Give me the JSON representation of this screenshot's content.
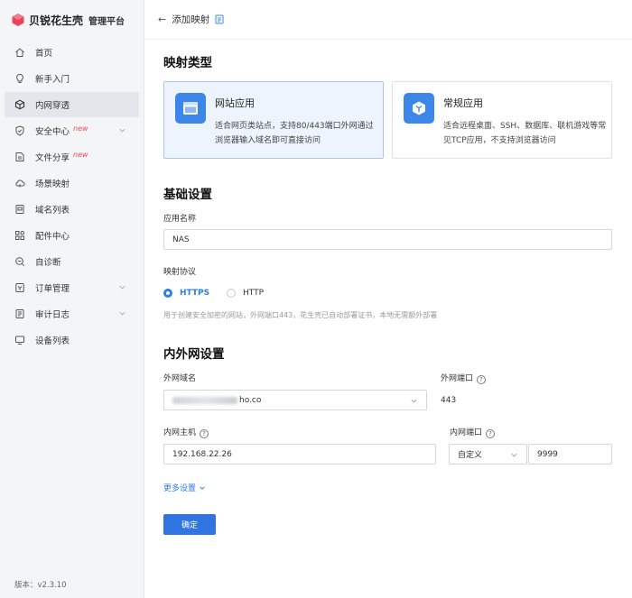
{
  "brand": {
    "name": "贝锐花生壳",
    "subtitle": "管理平台"
  },
  "sidebar": {
    "items": [
      {
        "label": "首页",
        "icon": "home-icon"
      },
      {
        "label": "新手入门",
        "icon": "lightbulb-icon"
      },
      {
        "label": "内网穿透",
        "icon": "cube-icon",
        "active": true
      },
      {
        "label": "安全中心",
        "icon": "shield-icon",
        "badge": "new"
      },
      {
        "label": "文件分享",
        "icon": "file-share-icon",
        "badge": "new"
      },
      {
        "label": "场景映射",
        "icon": "cloud-icon"
      },
      {
        "label": "域名列表",
        "icon": "domain-icon"
      },
      {
        "label": "配件中心",
        "icon": "grid-icon"
      },
      {
        "label": "自诊断",
        "icon": "diagnose-icon"
      },
      {
        "label": "订单管理",
        "icon": "order-icon"
      },
      {
        "label": "审计日志",
        "icon": "log-icon"
      },
      {
        "label": "设备列表",
        "icon": "monitor-icon"
      }
    ],
    "version": "版本：v2.3.10"
  },
  "header": {
    "back": "←",
    "title": "添加映射"
  },
  "mapping_type": {
    "title": "映射类型",
    "cards": [
      {
        "title": "网站应用",
        "desc": "适合网页类站点，支持80/443端口外网通过浏览器输入域名即可直接访问",
        "selected": true,
        "icon": "browser-window-icon"
      },
      {
        "title": "常规应用",
        "desc": "适合远程桌面、SSH、数据库、联机游戏等常见TCP应用，不支持浏览器访问",
        "selected": false,
        "icon": "box-icon"
      }
    ]
  },
  "basic": {
    "title": "基础设置",
    "app_name_label": "应用名称",
    "app_name_value": "NAS",
    "protocol_label": "映射协议",
    "protocol_options": [
      "HTTPS",
      "HTTP"
    ],
    "protocol_selected": "HTTPS",
    "protocol_hint": "用于创建安全加密的网站，外网端口443，花生壳已自动部署证书，本地无需额外部署"
  },
  "network": {
    "title": "内外网设置",
    "ext_domain_label": "外网域名",
    "ext_domain_suffix": "ho.co",
    "ext_port_label": "外网端口",
    "ext_port_value": "443",
    "int_host_label": "内网主机",
    "int_host_value": "192.168.22.26",
    "int_port_label": "内网端口",
    "int_port_mode": "自定义",
    "int_port_value": "9999",
    "more_settings": "更多设置"
  },
  "submit_label": "确定",
  "colors": {
    "accent": "#2f74e0",
    "brand": "#e8455d"
  }
}
